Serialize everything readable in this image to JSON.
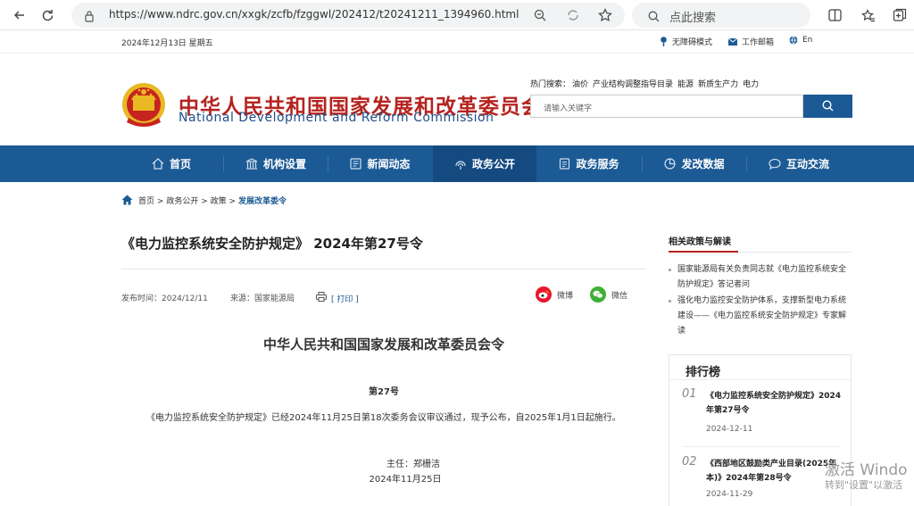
{
  "browser": {
    "url": "https://www.ndrc.gov.cn/xxgk/zcfb/fzggwl/202412/t20241211_1394960.html",
    "search_placeholder": "点此搜索"
  },
  "topbar": {
    "date": "2024年12月13日 星期五",
    "accessibility": "无障碍模式",
    "mail": "工作邮箱",
    "lang": "En"
  },
  "header": {
    "name_cn": "中华人民共和国国家发展和改革委员会",
    "name_en": "National Development and Reform Commission",
    "hot_label": "热门搜索：",
    "hot_items": [
      "油价",
      "产业结构调整指导目录",
      "能源",
      "新质生产力",
      "电力"
    ],
    "search_placeholder": "请输入关键字"
  },
  "nav": {
    "items": [
      {
        "label": "首页",
        "icon": "home-icon"
      },
      {
        "label": "机构设置",
        "icon": "institution-icon"
      },
      {
        "label": "新闻动态",
        "icon": "news-icon"
      },
      {
        "label": "政务公开",
        "icon": "broadcast-icon"
      },
      {
        "label": "政务服务",
        "icon": "service-icon"
      },
      {
        "label": "发改数据",
        "icon": "data-chart-icon"
      },
      {
        "label": "互动交流",
        "icon": "chat-icon"
      }
    ],
    "active": "政务公开"
  },
  "breadcrumb": {
    "items": [
      "首页",
      "政务公开",
      "政策"
    ],
    "current": "发展改革委令",
    "sep": ">"
  },
  "article": {
    "title": "《电力监控系统安全防护规定》 2024年第27号令",
    "publish_time": "发布时间：2024/12/11",
    "source": "来源：国家能源局",
    "print": "[ 打印 ]",
    "share_weibo": "微博",
    "share_wechat": "微信",
    "heading": "中华人民共和国国家发展和改革委员会令",
    "number": "第27号",
    "body": "《电力监控系统安全防护规定》已经2024年11月25日第18次委务会议审议通过，现予公布，自2025年1月1日起施行。",
    "signer": "主任：郑栅洁",
    "date": "2024年11月25日"
  },
  "sidebar": {
    "related_title": "相关政策与解读",
    "related": [
      "国家能源局有关负责同志就《电力监控系统安全防护规定》答记者问",
      "强化电力监控安全防护体系，支撑新型电力系统建设——《电力监控系统安全防护规定》专家解读"
    ],
    "ranking_title": "排行榜",
    "ranking": [
      {
        "rank": "01",
        "title": "《电力监控系统安全防护规定》2024年第27号令",
        "date": "2024-12-11"
      },
      {
        "rank": "02",
        "title": "《西部地区鼓励类产业目录(2025年本)》2024年第28号令",
        "date": "2024-11-29"
      }
    ]
  },
  "watermark": {
    "line1": "激活 Windo",
    "line2": "转到\"设置\"以激活"
  }
}
